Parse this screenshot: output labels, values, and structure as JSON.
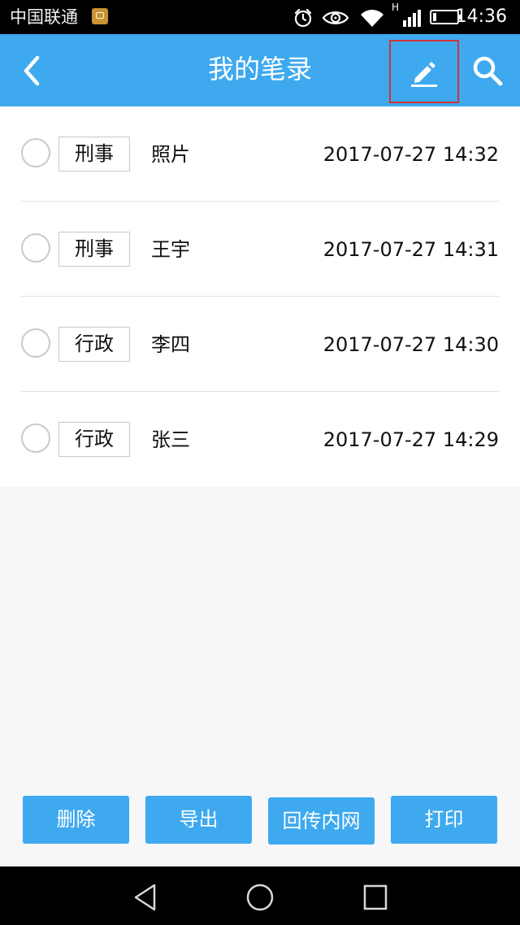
{
  "status_bar": {
    "carrier": "中国联通",
    "time": "14:36",
    "network_label": "H"
  },
  "header": {
    "title": "我的笔录",
    "background_color": "#3ea9ef",
    "icons": {
      "back": "back-arrow-icon",
      "edit": "pencil-icon",
      "search": "search-icon"
    }
  },
  "notes": [
    {
      "category": "刑事",
      "name": "照片",
      "time": "2017-07-27 14:32"
    },
    {
      "category": "刑事",
      "name": "王宇",
      "time": "2017-07-27 14:31"
    },
    {
      "category": "行政",
      "name": "李四",
      "time": "2017-07-27 14:30"
    },
    {
      "category": "行政",
      "name": "张三",
      "time": "2017-07-27 14:29"
    }
  ],
  "actions": {
    "delete": "删除",
    "export": "导出",
    "send_back": "回传内网",
    "print": "打印"
  }
}
